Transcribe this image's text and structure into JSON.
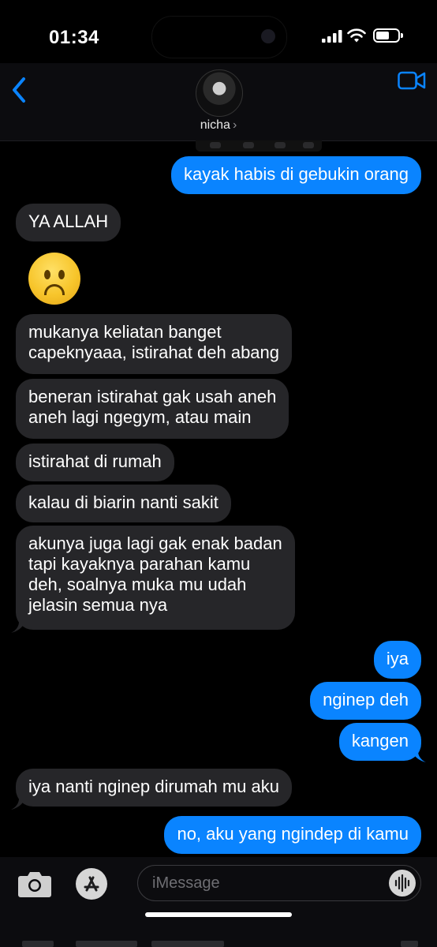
{
  "status_bar": {
    "time": "01:34",
    "battery_level": 0.6
  },
  "header": {
    "contact_name": "nicha",
    "chevron": "›"
  },
  "messages": [
    {
      "dir": "out",
      "text": "kayak habis di gebukin orang"
    },
    {
      "dir": "in",
      "text": "YA ALLAH"
    },
    {
      "dir": "in",
      "type": "emoji",
      "emoji": "frowning-face"
    },
    {
      "dir": "in",
      "text": "mukanya keliatan banget\ncapeknyaaa, istirahat deh abang"
    },
    {
      "dir": "in",
      "text": "beneran istirahat gak usah aneh\naneh lagi ngegym, atau main"
    },
    {
      "dir": "in",
      "text": "istirahat di rumah"
    },
    {
      "dir": "in",
      "text": "kalau di biarin nanti sakit"
    },
    {
      "dir": "in",
      "text": "akunya juga lagi gak enak badan\ntapi kayaknya parahan kamu\ndeh, soalnya muka mu udah\njelasin semua nya"
    },
    {
      "dir": "out",
      "text": "iya"
    },
    {
      "dir": "out",
      "text": "nginep deh"
    },
    {
      "dir": "out",
      "text": "kangen"
    },
    {
      "dir": "in",
      "text": "iya nanti nginep dirumah mu aku"
    },
    {
      "dir": "out",
      "text": "no, aku yang ngindep di kamu"
    }
  ],
  "composer": {
    "placeholder": "iMessage"
  },
  "colors": {
    "outgoing": "#0a84ff",
    "incoming": "#262629",
    "accent": "#0a84ff",
    "background": "#000000"
  },
  "icons": [
    "back-chevron-icon",
    "video-call-icon",
    "camera-icon",
    "app-store-icon",
    "audio-waveform-icon"
  ]
}
